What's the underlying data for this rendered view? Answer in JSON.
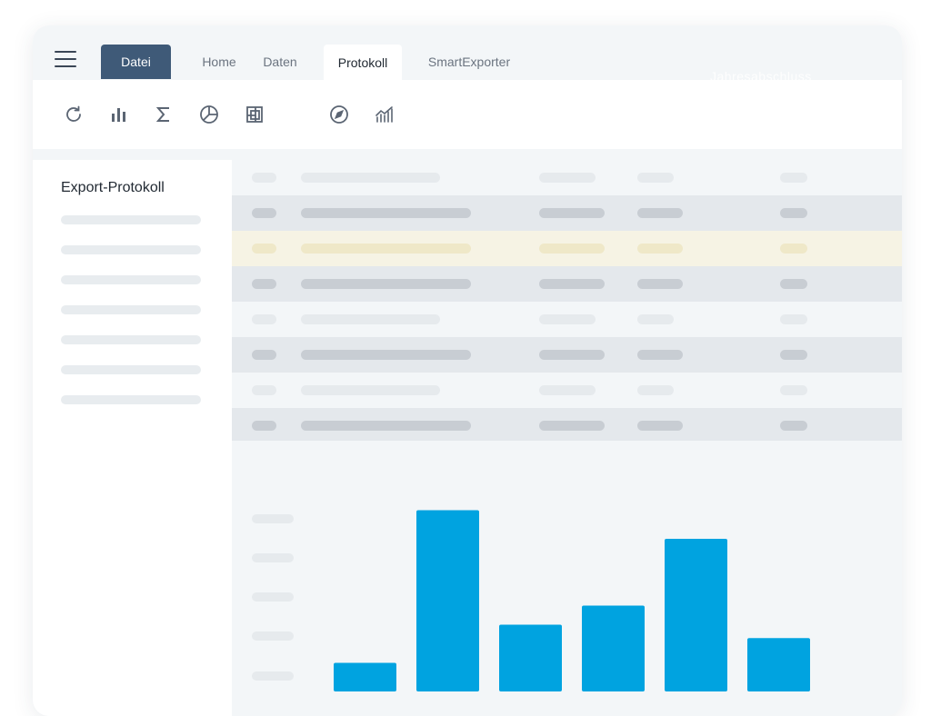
{
  "tabs": [
    {
      "label": "Datei",
      "active": true,
      "style": "primary"
    },
    {
      "label": "Home",
      "active": false
    },
    {
      "label": "Daten",
      "active": false
    },
    {
      "label": "Protokoll",
      "active": true,
      "style": "selected"
    },
    {
      "label": "SmartExporter",
      "active": false
    }
  ],
  "header": {
    "faded_title": "Jahresabschluss"
  },
  "toolbar": {
    "icons": [
      "refresh-icon",
      "bar-chart-icon",
      "sum-icon",
      "pie-chart-icon",
      "layout-icon",
      "compass-icon",
      "line-chart-icon"
    ]
  },
  "sidebar": {
    "title": "Export-Protokoll",
    "placeholder_line_count": 7
  },
  "table": {
    "row_styles": [
      "header",
      "dark",
      "highlight",
      "dark",
      "light",
      "dark",
      "light",
      "dark"
    ]
  },
  "chart_data": {
    "type": "bar",
    "categories": [
      "",
      "",
      "",
      "",
      "",
      ""
    ],
    "values": [
      15,
      95,
      35,
      45,
      80,
      28
    ],
    "ylim": [
      0,
      100
    ],
    "grid": false,
    "bar_color": "#00a3e0"
  },
  "colors": {
    "accent": "#3f5a78",
    "bar": "#00a3e0",
    "highlight_row": "#f6f3e4"
  }
}
